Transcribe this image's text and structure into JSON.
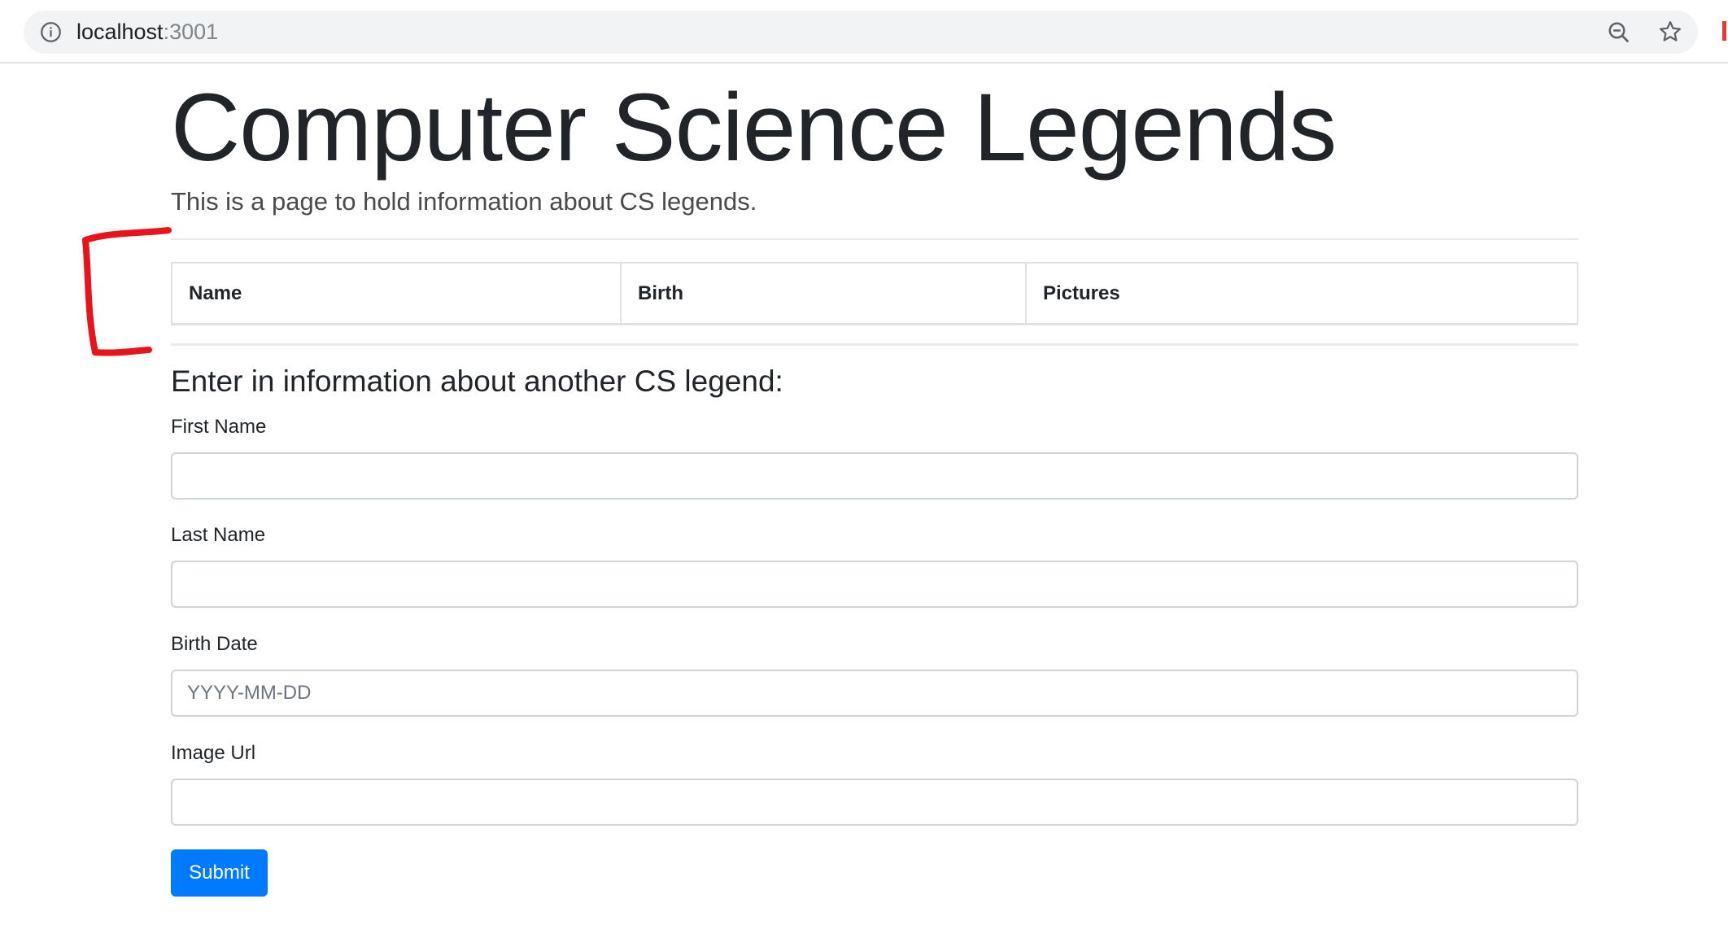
{
  "browser": {
    "url_host": "localhost",
    "url_port": ":3001",
    "icons": [
      "info-icon",
      "zoom-icon",
      "star-icon"
    ]
  },
  "page": {
    "title": "Computer Science Legends",
    "lead": "This is a page to hold information about CS legends."
  },
  "table": {
    "columns": [
      "Name",
      "Birth",
      "Pictures"
    ]
  },
  "form": {
    "heading": "Enter in information about another CS legend:",
    "fields": [
      {
        "label": "First Name",
        "value": "",
        "placeholder": ""
      },
      {
        "label": "Last Name",
        "value": "",
        "placeholder": ""
      },
      {
        "label": "Birth Date",
        "value": "",
        "placeholder": "YYYY-MM-DD"
      },
      {
        "label": "Image Url",
        "value": "",
        "placeholder": ""
      }
    ],
    "submit_label": "Submit"
  },
  "colors": {
    "primary": "#007bff",
    "annotation": "#e8141b"
  }
}
